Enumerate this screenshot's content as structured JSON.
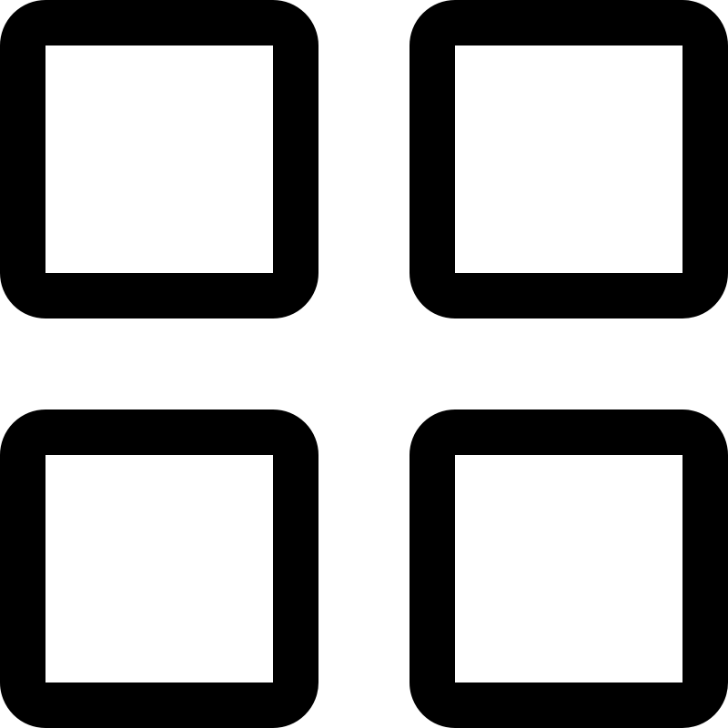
{
  "icon": {
    "name": "grid-view-icon",
    "cells": [
      {
        "name": "grid-cell-top-left-icon"
      },
      {
        "name": "grid-cell-top-right-icon"
      },
      {
        "name": "grid-cell-bottom-left-icon"
      },
      {
        "name": "grid-cell-bottom-right-icon"
      }
    ]
  },
  "colors": {
    "stroke": "#000000",
    "background": "#ffffff"
  }
}
